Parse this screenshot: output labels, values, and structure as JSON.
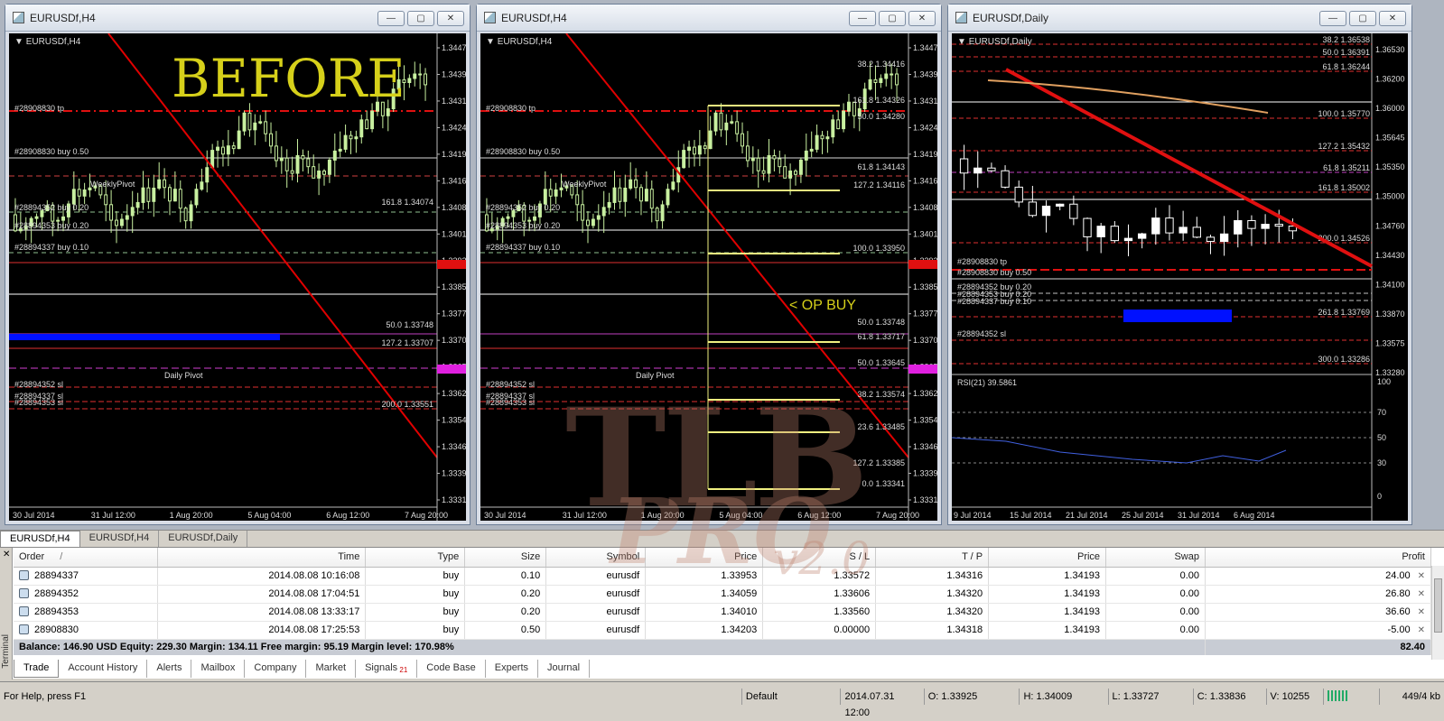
{
  "windows": [
    {
      "title": "EURUSDf,H4",
      "symbol_label": "EURUSDf,H4",
      "overlay_text": "BEFORE",
      "prices": [
        "1.34470",
        "1.34395",
        "1.34315",
        "1.34240",
        "1.34194",
        "1.34160",
        "1.34085",
        "1.34010",
        "1.33929",
        "1.33850",
        "1.33775",
        "1.33700",
        "1.33657",
        "1.33620",
        "1.33545",
        "1.33465",
        "1.33390",
        "1.33315"
      ],
      "dates": [
        "30 Jul 2014",
        "31 Jul 12:00",
        "1 Aug 20:00",
        "5 Aug 04:00",
        "6 Aug 12:00",
        "7 Aug 20:00"
      ],
      "labels": [
        "#28908830 tp",
        "#28908830 buy 0.50",
        "#28894352 buy 0.20",
        "#28894353 buy 0.20",
        "#28894337 buy 0.10",
        "#28894352 sl",
        "#28894337 sl",
        "#28894353 sl"
      ],
      "fib_labels": [
        "161.8 1.34074",
        "50.0 1.33748",
        "127.2 1.33707",
        "200.0 1.33551"
      ],
      "pivot_labels": [
        "WeeklyPivot",
        "Daily Pivot"
      ]
    },
    {
      "title": "EURUSDf,H4",
      "symbol_label": "EURUSDf,H4",
      "overlay_text": "< OP BUY",
      "prices": [
        "1.34470",
        "1.34395",
        "1.34315",
        "1.34240",
        "1.34194",
        "1.34160",
        "1.34085",
        "1.34010",
        "1.33929",
        "1.33855",
        "1.33775",
        "1.33700",
        "1.33657",
        "1.33620",
        "1.33545",
        "1.33465",
        "1.33390",
        "1.33315"
      ],
      "dates": [
        "30 Jul 2014",
        "31 Jul 12:00",
        "1 Aug 20:00",
        "5 Aug 04:00",
        "6 Aug 12:00",
        "7 Aug 20:00"
      ],
      "labels": [
        "#28908830 tp",
        "#28908830 buy 0.50",
        "#28894352 buy 0.20",
        "#28894353 buy 0.20",
        "#28894337 buy 0.10",
        "#28894352 sl",
        "#28894337 sl",
        "#28894353 sl"
      ],
      "fib_labels": [
        "38.2 1.34416",
        "161.8 1.34326",
        "50.0 1.34280",
        "61.8 1.34143",
        "127.2 1.34116",
        "100.0 1.33950",
        "50.0 1.33748",
        "61.8 1.33717",
        "50.0 1.33645",
        "38.2 1.33574",
        "23.6 1.33485",
        "127.2 1.33385",
        "0.0 1.33341"
      ],
      "pivot_labels": [
        "WeeklyPivot",
        "Daily Pivot"
      ]
    },
    {
      "title": "EURUSDf,Daily",
      "symbol_label": "EURUSDf,Daily",
      "prices": [
        "1.36530",
        "1.36200",
        "1.36000",
        "1.35645",
        "1.35350",
        "1.35000",
        "1.34760",
        "1.34430",
        "1.34100",
        "1.33870",
        "1.33575",
        "1.33280"
      ],
      "rsi_label": "RSI(21) 39.5861",
      "rsi_levels": [
        "100",
        "70",
        "50",
        "30",
        "0"
      ],
      "dates": [
        "9 Jul 2014",
        "15 Jul 2014",
        "21 Jul 2014",
        "25 Jul 2014",
        "31 Jul 2014",
        "6 Aug 2014"
      ],
      "labels": [
        "#28908830 tp",
        "#28908830 buy 0.50",
        "#28894352 buy 0.20",
        "#28894353 buy 0.20",
        "#28894337 buy 0.10",
        "#28894352 sl"
      ],
      "fib_labels": [
        "38.2 1.36538",
        "50.0 1.36391",
        "61.8 1.36244",
        "100.0 1.35770",
        "127.2 1.35432",
        "61.8 1.35211",
        "161.8 1.35002",
        "200.0 1.34526",
        "261.8 1.33769",
        "300.0 1.33286"
      ]
    }
  ],
  "chart_tabs": [
    "EURUSDf,H4",
    "EURUSDf,H4",
    "EURUSDf,Daily"
  ],
  "table": {
    "headers": [
      "Order",
      "Time",
      "Type",
      "Size",
      "Symbol",
      "Price",
      "S / L",
      "T / P",
      "Price",
      "Swap",
      "Profit"
    ],
    "sort_mark": "/",
    "rows": [
      [
        "28894337",
        "2014.08.08 10:16:08",
        "buy",
        "0.10",
        "eurusdf",
        "1.33953",
        "1.33572",
        "1.34316",
        "1.34193",
        "0.00",
        "24.00"
      ],
      [
        "28894352",
        "2014.08.08 17:04:51",
        "buy",
        "0.20",
        "eurusdf",
        "1.34059",
        "1.33606",
        "1.34320",
        "1.34193",
        "0.00",
        "26.80"
      ],
      [
        "28894353",
        "2014.08.08 13:33:17",
        "buy",
        "0.20",
        "eurusdf",
        "1.34010",
        "1.33560",
        "1.34320",
        "1.34193",
        "0.00",
        "36.60"
      ],
      [
        "28908830",
        "2014.08.08 17:25:53",
        "buy",
        "0.50",
        "eurusdf",
        "1.34203",
        "0.00000",
        "1.34318",
        "1.34193",
        "0.00",
        "-5.00"
      ]
    ],
    "balance_text": "Balance: 146.90 USD  Equity: 229.30  Margin: 134.11  Free margin: 95.19  Margin level: 170.98%",
    "total_profit": "82.40"
  },
  "terminal": {
    "side_label": "Terminal",
    "tabs": [
      "Trade",
      "Account History",
      "Alerts",
      "Mailbox",
      "Company",
      "Market",
      "Signals",
      "Code Base",
      "Experts",
      "Journal"
    ],
    "signals_badge": "21"
  },
  "status": {
    "help": "For Help, press F1",
    "profile": "Default",
    "datetime": "2014.07.31 12:00",
    "open": "O: 1.33925",
    "high": "H: 1.34009",
    "low": "L: 1.33727",
    "close": "C: 1.33836",
    "volume": "V: 10255",
    "traffic": "449/4 kb"
  },
  "watermark": {
    "line1": "TLB",
    "line2": "PRO",
    "line3": "v2.0"
  },
  "colors": {
    "up_candle": "#ffffff",
    "candle_h4": "#c8f0a0",
    "trend_line": "#e00000",
    "fib_red": "#e03030",
    "fib_yellow": "#f0f080",
    "pivot_magenta": "#c040c0",
    "blue_zone": "#0010ff",
    "overlay_yellow": "#d6d01a"
  }
}
